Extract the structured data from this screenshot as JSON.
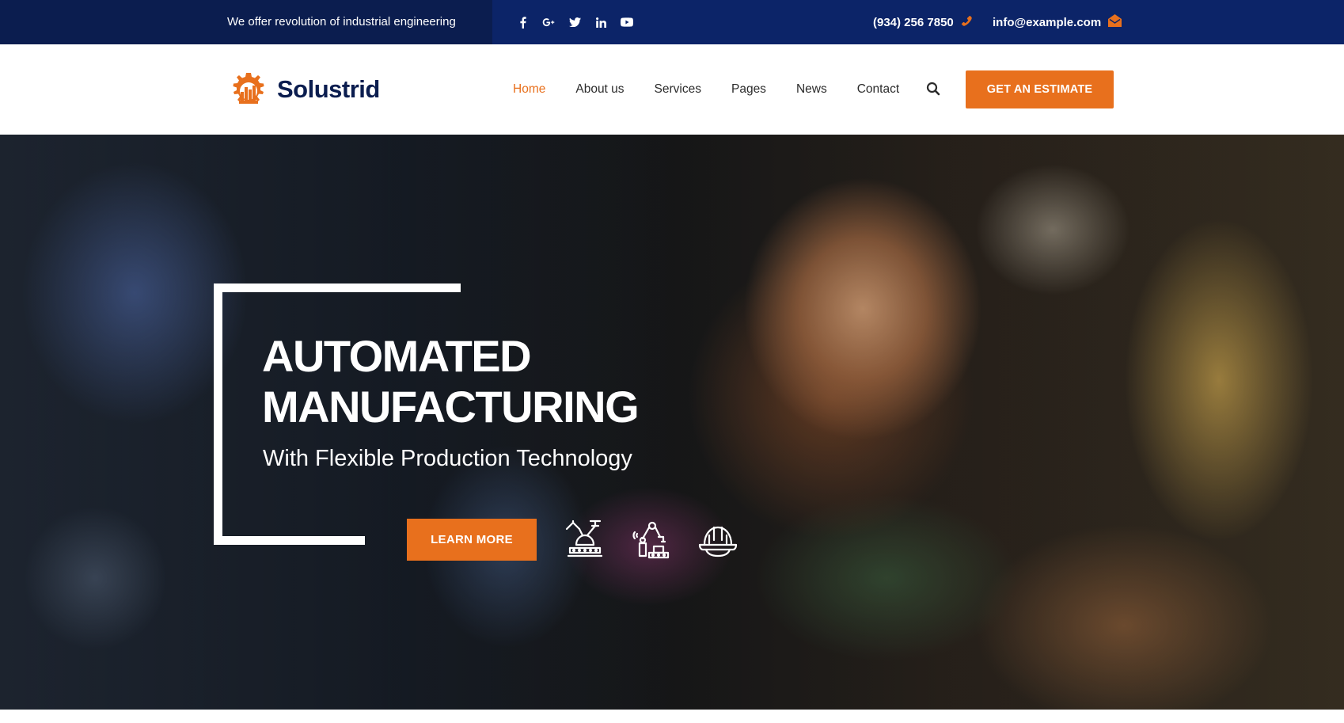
{
  "topbar": {
    "tagline": "We offer revolution of industrial engineering",
    "socials": [
      "facebook-icon",
      "google-plus-icon",
      "twitter-icon",
      "linkedin-icon",
      "youtube-icon"
    ],
    "phone": "(934) 256 7850",
    "email": "info@example.com"
  },
  "header": {
    "logo_text": "Solustrid",
    "nav": [
      "Home",
      "About us",
      "Services",
      "Pages",
      "News",
      "Contact"
    ],
    "active_nav": "Home",
    "cta_label": "GET AN ESTIMATE"
  },
  "hero": {
    "title_line1": "AUTOMATED",
    "title_line2": "MANUFACTURING",
    "subtitle": "With Flexible Production Technology",
    "button_label": "LEARN MORE",
    "feature_icons": [
      "robotic-assembly-icon",
      "robot-arm-icon",
      "hard-hat-icon"
    ]
  },
  "colors": {
    "topbar_bg": "#0c2468",
    "topbar_left_bg": "#0b1d4f",
    "accent": "#e8701d",
    "brand_text": "#0b1d4f"
  }
}
